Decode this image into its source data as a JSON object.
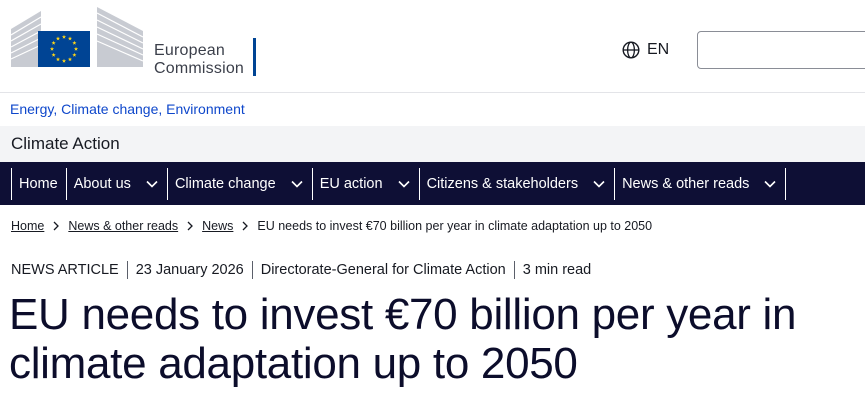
{
  "header": {
    "logo": {
      "line1": "European",
      "line2": "Commission"
    },
    "language": {
      "code": "EN",
      "icon": "globe-icon"
    },
    "search": {
      "value": "",
      "placeholder": ""
    }
  },
  "site": {
    "topics": "Energy, Climate change, Environment",
    "name": "Climate Action"
  },
  "nav": {
    "items": [
      {
        "label": "Home",
        "has_dropdown": false
      },
      {
        "label": "About us",
        "has_dropdown": true
      },
      {
        "label": "Climate change",
        "has_dropdown": true
      },
      {
        "label": "EU action",
        "has_dropdown": true
      },
      {
        "label": "Citizens & stakeholders",
        "has_dropdown": true
      },
      {
        "label": "News & other reads",
        "has_dropdown": true
      }
    ]
  },
  "breadcrumb": {
    "items": [
      "Home",
      "News & other reads",
      "News"
    ],
    "current": "EU needs to invest €70 billion per year in climate adaptation up to 2050"
  },
  "article": {
    "type": "NEWS ARTICLE",
    "date": "23 January 2026",
    "author": "Directorate-General for Climate Action",
    "read_time": "3 min read",
    "title": "EU needs to invest €70 billion per year in climate adaptation up to 2050"
  },
  "colors": {
    "nav_background": "#0e0f35",
    "link": "#0e47cb",
    "brand_blue": "#004494",
    "brand_star": "#ffd617"
  }
}
